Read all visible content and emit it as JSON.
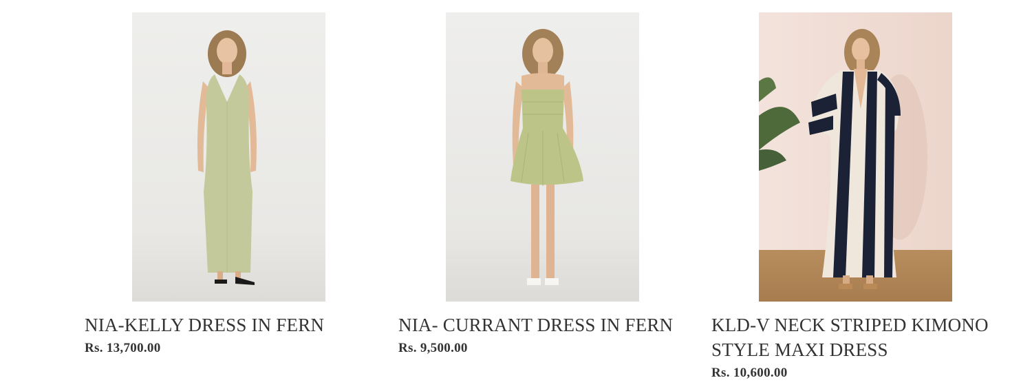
{
  "products": [
    {
      "title": "NIA-KELLY DRESS IN FERN",
      "price": "Rs. 13,700.00",
      "image_icon": "product-photo-maxi-halter-dress",
      "dress_color": "#c3c99a"
    },
    {
      "title": "NIA- CURRANT DRESS IN FERN",
      "price": "Rs. 9,500.00",
      "image_icon": "product-photo-strapless-mini-dress",
      "dress_color": "#bcc587"
    },
    {
      "title": "KLD-V NECK STRIPED KIMONO STYLE MAXI DRESS",
      "price": "Rs. 10,600.00",
      "image_icon": "product-photo-striped-kimono-dress",
      "dress_color": "#1c2235"
    }
  ]
}
